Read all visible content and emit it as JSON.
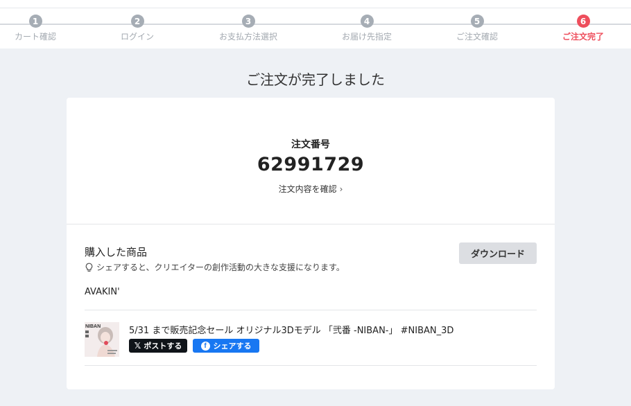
{
  "steps": [
    {
      "num": "1",
      "label": "カート確認"
    },
    {
      "num": "2",
      "label": "ログイン"
    },
    {
      "num": "3",
      "label": "お支払方法選択"
    },
    {
      "num": "4",
      "label": "お届け先指定"
    },
    {
      "num": "5",
      "label": "ご注文確認"
    },
    {
      "num": "6",
      "label": "ご注文完了"
    }
  ],
  "active_step": 6,
  "page_title": "ご注文が完了しました",
  "order": {
    "label": "注文番号",
    "number": "62991729",
    "link": "注文内容を確認",
    "link_chevron": "›"
  },
  "purchase": {
    "title": "購入した商品",
    "hint": "シェアすると、クリエイターの創作活動の大きな支援になります。",
    "download_label": "ダウンロード",
    "creator": "AVAKIN'",
    "item_title": "5/31 まで販売記念セール オリジナル3Dモデル 「弐番 -NIBAN-」 #NIBAN_3D",
    "thumb_text": "NIBAN",
    "x_icon": "𝕏",
    "x_label": "ポストする",
    "fb_icon": "f",
    "fb_label": "シェアする"
  },
  "colors": {
    "accent": "#ee4e5c",
    "step_inactive": "#a6adb5",
    "facebook": "#1877f2",
    "x": "#0f1419",
    "background": "#eef1f5"
  }
}
